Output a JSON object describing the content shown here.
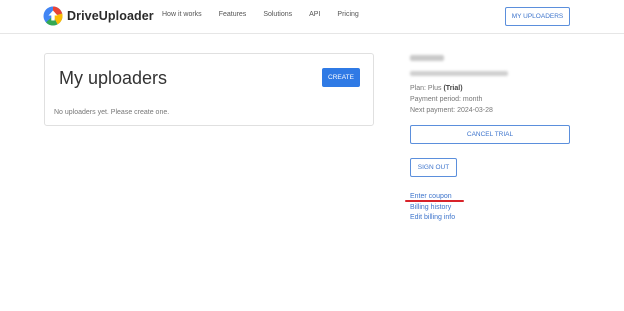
{
  "header": {
    "brand": "DriveUploader",
    "nav": [
      "How it works",
      "Features",
      "Solutions",
      "API",
      "Pricing"
    ],
    "my_uploaders_button": "MY UPLOADERS"
  },
  "main": {
    "title": "My uploaders",
    "create_button": "CREATE",
    "empty_message": "No uploaders yet. Please create one."
  },
  "account": {
    "plan_label": "Plan: Plus ",
    "plan_status": "(Trial)",
    "payment_period": "Payment period: month",
    "next_payment": "Next payment: 2024-03-28",
    "cancel_trial_button": "CANCEL TRIAL",
    "sign_out_button": "SIGN OUT",
    "links": [
      "Enter coupon",
      "Billing history",
      "Edit billing info"
    ]
  },
  "colors": {
    "accent": "#2f7ae5",
    "annotation": "#d8232a"
  }
}
